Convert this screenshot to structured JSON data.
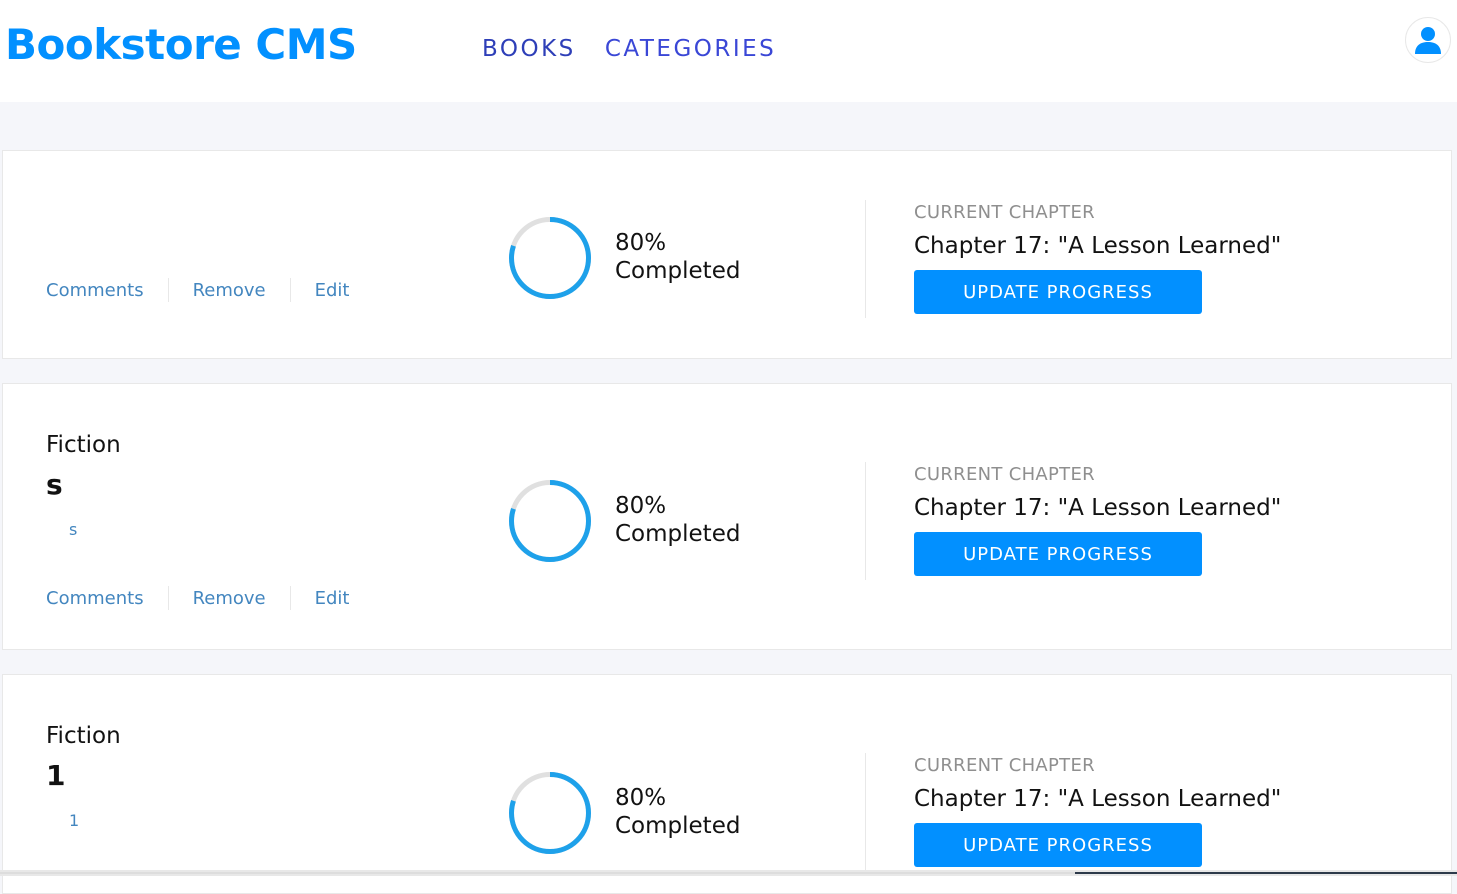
{
  "header": {
    "logo": "Bookstore CMS",
    "nav": [
      {
        "label": "BOOKS"
      },
      {
        "label": "CATEGORIES"
      }
    ],
    "avatar_icon": "user-icon"
  },
  "colors": {
    "brand": "#0290ff",
    "nav": "#3a47d6",
    "link": "#4386bf",
    "ring_fill": "#1ea1ea",
    "ring_track": "#e0e0e0"
  },
  "books": [
    {
      "genre": "",
      "title": "",
      "author": "",
      "actions": [
        "Comments",
        "Remove",
        "Edit"
      ],
      "progress_percent": 80,
      "percent_label": "80%",
      "completed_label": "Completed",
      "chapter_label": "CURRENT CHAPTER",
      "chapter": "Chapter 17: \"A Lesson Learned\"",
      "update_button": "UPDATE PROGRESS"
    },
    {
      "genre": "Fiction",
      "title": "s",
      "author": "s",
      "actions": [
        "Comments",
        "Remove",
        "Edit"
      ],
      "progress_percent": 80,
      "percent_label": "80%",
      "completed_label": "Completed",
      "chapter_label": "CURRENT CHAPTER",
      "chapter": "Chapter 17: \"A Lesson Learned\"",
      "update_button": "UPDATE PROGRESS"
    },
    {
      "genre": "Fiction",
      "title": "1",
      "author": "1",
      "actions": [],
      "progress_percent": 80,
      "percent_label": "80%",
      "completed_label": "Completed",
      "chapter_label": "CURRENT CHAPTER",
      "chapter": "Chapter 17: \"A Lesson Learned\"",
      "update_button": "UPDATE PROGRESS"
    }
  ]
}
